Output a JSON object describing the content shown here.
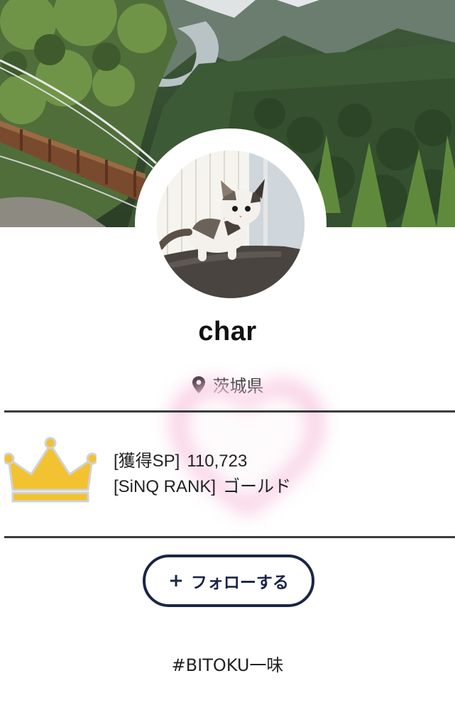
{
  "profile": {
    "name": "char",
    "location": "茨城県"
  },
  "rank": {
    "points_label": "[獲得SP]",
    "points_value": "110,723",
    "rank_label": "[SiNQ RANK]",
    "rank_value": "ゴールド"
  },
  "actions": {
    "follow_plus": "+",
    "follow_label": "フォローする"
  },
  "hashtag": "#BITOKU一味",
  "icons": {
    "location": "map-pin-icon",
    "rank": "crown-icon"
  },
  "colors": {
    "crown": "#f2c230",
    "button_border": "#1b2547",
    "divider": "#3b3b3b",
    "heart_glow": "#f3a0c8"
  }
}
